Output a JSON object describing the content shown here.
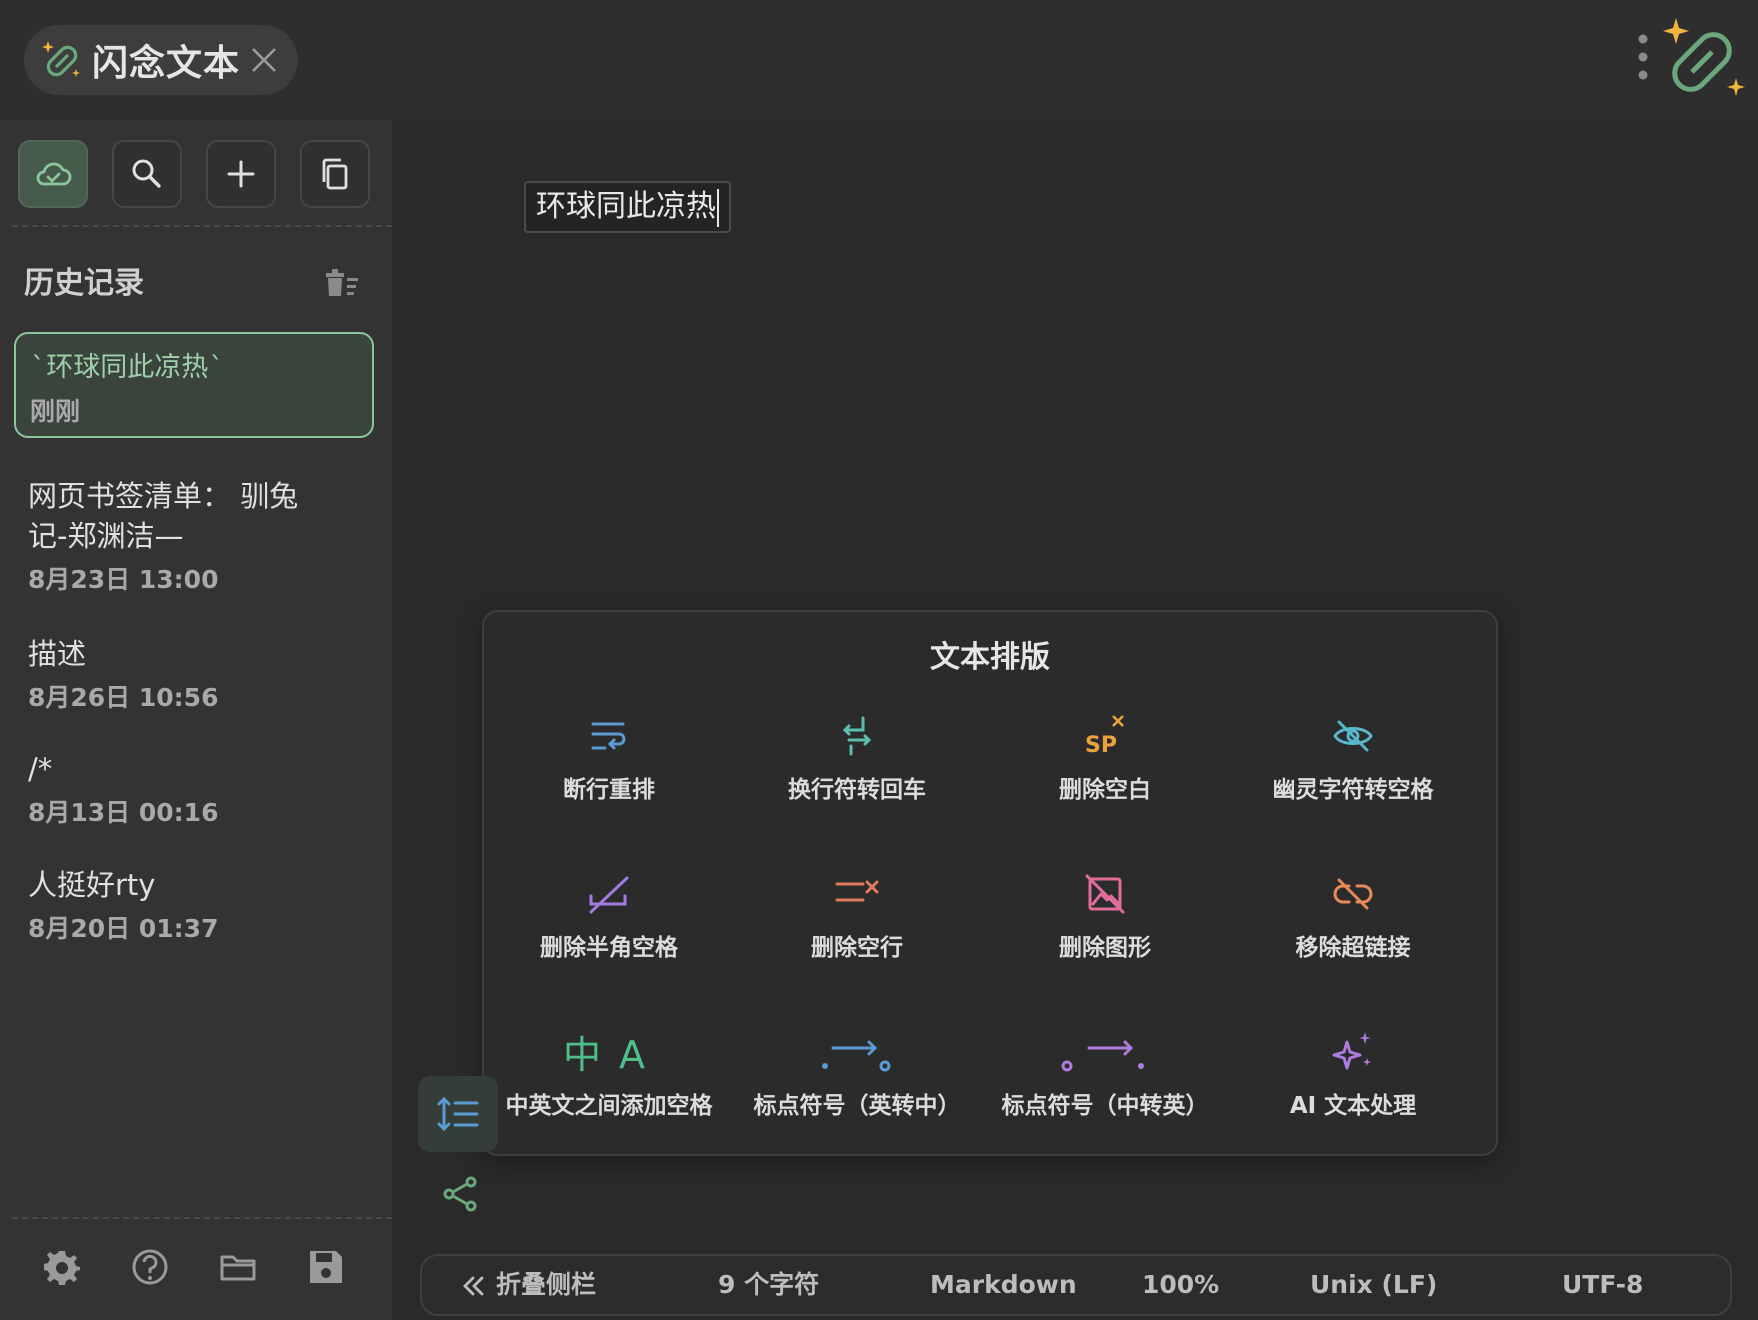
{
  "tab": {
    "title": "闪念文本"
  },
  "sidebar": {
    "history_title": "历史记录",
    "items": [
      {
        "text": "`环球同此凉热`",
        "time": "刚刚",
        "selected": true
      },
      {
        "text": "网页书签清单：  驯兔记-郑渊洁—",
        "time": "8月23日 13:00"
      },
      {
        "text": "描述",
        "time": "8月26日 10:56"
      },
      {
        "text": "/*",
        "time": "8月13日 00:16"
      },
      {
        "text": "人挺好rty",
        "time": "8月20日 01:37"
      }
    ]
  },
  "editor": {
    "content": "环球同此凉热"
  },
  "panel": {
    "title": "文本排版",
    "actions": [
      {
        "label": "断行重排",
        "icon": "rewrap-icon",
        "color": "#5b9bd5"
      },
      {
        "label": "换行符转回车",
        "icon": "newline-to-return-icon",
        "color": "#5bbfb0"
      },
      {
        "label": "删除空白",
        "icon": "remove-whitespace-icon",
        "color": "#e8a33c"
      },
      {
        "label": "幽灵字符转空格",
        "icon": "ghost-char-icon",
        "color": "#5ab7c9"
      },
      {
        "label": "删除半角空格",
        "icon": "remove-halfwidth-space-icon",
        "color": "#a07be0"
      },
      {
        "label": "删除空行",
        "icon": "remove-empty-lines-icon",
        "color": "#e07a5f"
      },
      {
        "label": "删除图形",
        "icon": "remove-image-icon",
        "color": "#e26c9a"
      },
      {
        "label": "移除超链接",
        "icon": "unlink-icon",
        "color": "#e8895a"
      },
      {
        "label": "中英文之间添加空格",
        "icon": "cjk-spacing-icon",
        "color": "#4fbf8a"
      },
      {
        "label": "标点符号（英转中）",
        "icon": "punct-en-to-zh-icon",
        "color": "#5b9bd5"
      },
      {
        "label": "标点符号（中转英）",
        "icon": "punct-zh-to-en-icon",
        "color": "#b07be0"
      },
      {
        "label": "AI 文本处理",
        "icon": "ai-sparkle-icon",
        "color": "#b07be0"
      }
    ]
  },
  "status": {
    "collapse_label": "折叠侧栏",
    "char_count": "9 个字符",
    "syntax": "Markdown",
    "zoom": "100%",
    "line_ending": "Unix (LF)",
    "encoding": "UTF-8"
  },
  "colors": {
    "accent": "#8bc79a",
    "background": "#2a2a2a",
    "sidebar": "#333333"
  }
}
